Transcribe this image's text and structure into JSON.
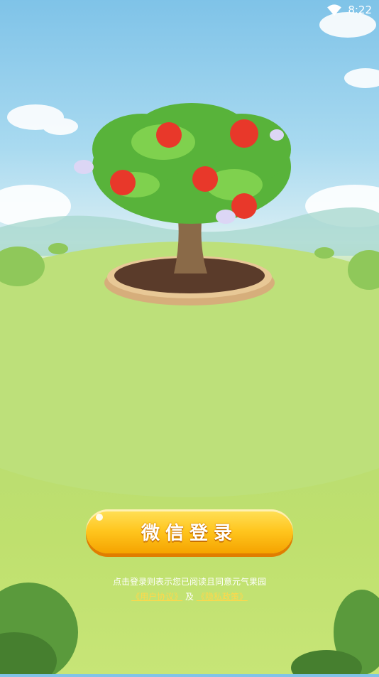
{
  "status_bar": {
    "time": "8:22"
  },
  "login": {
    "button_label": "微信登录"
  },
  "agreement": {
    "notice": "点击登录则表示您已阅读且同意元气果园",
    "user_agreement": "《用户协议》",
    "connector": "及",
    "privacy_policy": "《隐私政策》"
  },
  "colors": {
    "button": "#ffc51d",
    "link": "#ffd84a",
    "grass": "#b8dc72",
    "sky": "#7fc3e8"
  }
}
